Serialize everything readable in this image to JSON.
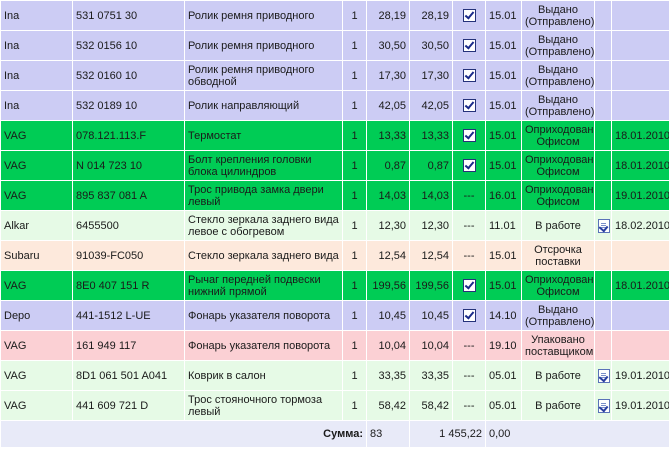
{
  "rows": [
    {
      "color": "blue",
      "brand": "Ina",
      "article": "531 0751 30",
      "name": "Ролик ремня приводного",
      "qty": "1",
      "price": "28,19",
      "sum": "28,19",
      "checked": true,
      "dash": "",
      "date": "15.01",
      "status": "Выдано (Отправлено)",
      "doc": false,
      "date2": ""
    },
    {
      "color": "blue",
      "brand": "Ina",
      "article": "532 0156 10",
      "name": "Ролик ремня приводного",
      "qty": "1",
      "price": "30,50",
      "sum": "30,50",
      "checked": true,
      "dash": "",
      "date": "15.01",
      "status": "Выдано (Отправлено)",
      "doc": false,
      "date2": ""
    },
    {
      "color": "blue",
      "brand": "Ina",
      "article": "532 0160 10",
      "name": "Ролик ремня приводного обводной",
      "qty": "1",
      "price": "17,30",
      "sum": "17,30",
      "checked": true,
      "dash": "",
      "date": "15.01",
      "status": "Выдано (Отправлено)",
      "doc": false,
      "date2": ""
    },
    {
      "color": "blue",
      "brand": "Ina",
      "article": "532 0189 10",
      "name": "Ролик направляющий",
      "qty": "1",
      "price": "42,05",
      "sum": "42,05",
      "checked": true,
      "dash": "",
      "date": "15.01",
      "status": "Выдано (Отправлено)",
      "doc": false,
      "date2": ""
    },
    {
      "color": "green",
      "brand": "VAG",
      "article": "078.121.113.F",
      "name": "Термостат",
      "qty": "1",
      "price": "13,33",
      "sum": "13,33",
      "checked": true,
      "dash": "",
      "date": "15.01",
      "status": "Оприходован Офисом",
      "doc": false,
      "date2": "18.01.2010"
    },
    {
      "color": "green",
      "brand": "VAG",
      "article": "N 014 723 10",
      "name": "Болт крепления головки блока цилиндров",
      "qty": "1",
      "price": "0,87",
      "sum": "0,87",
      "checked": true,
      "dash": "",
      "date": "15.01",
      "status": "Оприходован Офисом",
      "doc": false,
      "date2": "18.01.2010"
    },
    {
      "color": "green",
      "brand": "VAG",
      "article": "895 837 081 A",
      "name": "Трос привода замка двери левый",
      "qty": "1",
      "price": "14,03",
      "sum": "14,03",
      "checked": false,
      "dash": "---",
      "date": "16.01",
      "status": "Оприходован Офисом",
      "doc": false,
      "date2": "19.01.2010"
    },
    {
      "color": "lgreen",
      "brand": "Alkar",
      "article": "6455500",
      "name": "Стекло зеркала заднего вида левое с обогревом",
      "qty": "1",
      "price": "12,30",
      "sum": "12,30",
      "checked": false,
      "dash": "---",
      "date": "11.01",
      "status": "В работе",
      "doc": true,
      "date2": "18.02.2010"
    },
    {
      "color": "peach",
      "brand": "Subaru",
      "article": "91039-FC050",
      "name": "Стекло зеркала заднего вида",
      "qty": "1",
      "price": "12,54",
      "sum": "12,54",
      "checked": false,
      "dash": "---",
      "date": "15.01",
      "status": "Отсрочка поставки",
      "doc": false,
      "date2": ""
    },
    {
      "color": "green",
      "brand": "VAG",
      "article": "8E0 407 151 R",
      "name": "Рычаг передней подвески нижний прямой",
      "qty": "1",
      "price": "199,56",
      "sum": "199,56",
      "checked": true,
      "dash": "",
      "date": "15.01",
      "status": "Оприходован Офисом",
      "doc": false,
      "date2": "18.01.2010"
    },
    {
      "color": "blue",
      "brand": "Depo",
      "article": "441-1512 L-UE",
      "name": "Фонарь указателя поворота",
      "qty": "1",
      "price": "10,45",
      "sum": "10,45",
      "checked": true,
      "dash": "",
      "date": "14.10",
      "status": "Выдано (Отправлено)",
      "doc": false,
      "date2": ""
    },
    {
      "color": "pink",
      "brand": "VAG",
      "article": "161 949 117",
      "name": "Фонарь указателя поворота",
      "qty": "1",
      "price": "10,04",
      "sum": "10,04",
      "checked": false,
      "dash": "---",
      "date": "19.10",
      "status": "Упаковано поставщиком",
      "doc": false,
      "date2": ""
    },
    {
      "color": "lgreen",
      "brand": "VAG",
      "article": "8D1 061 501 A041",
      "name": "Коврик в салон",
      "qty": "1",
      "price": "33,35",
      "sum": "33,35",
      "checked": false,
      "dash": "---",
      "date": "05.01",
      "status": "В работе",
      "doc": true,
      "date2": "19.01.2010"
    },
    {
      "color": "lgreen",
      "brand": "VAG",
      "article": "441 609 721 D",
      "name": "Трос стояночного тормоза левый",
      "qty": "1",
      "price": "58,42",
      "sum": "58,42",
      "checked": false,
      "dash": "---",
      "date": "05.01",
      "status": "В работе",
      "doc": true,
      "date2": "19.01.2010"
    }
  ],
  "totals": {
    "label": "Сумма:",
    "qty": "83",
    "sum": "1 455,22",
    "extra": "0,00"
  },
  "colors": {
    "blue": "#ccccf4",
    "green": "#00cc55",
    "lgreen": "#e6fae6",
    "peach": "#fde9dc",
    "pink": "#fbd0d4"
  },
  "icons": {
    "checked": "checkbox-checked-icon",
    "doc": "document-check-icon"
  }
}
